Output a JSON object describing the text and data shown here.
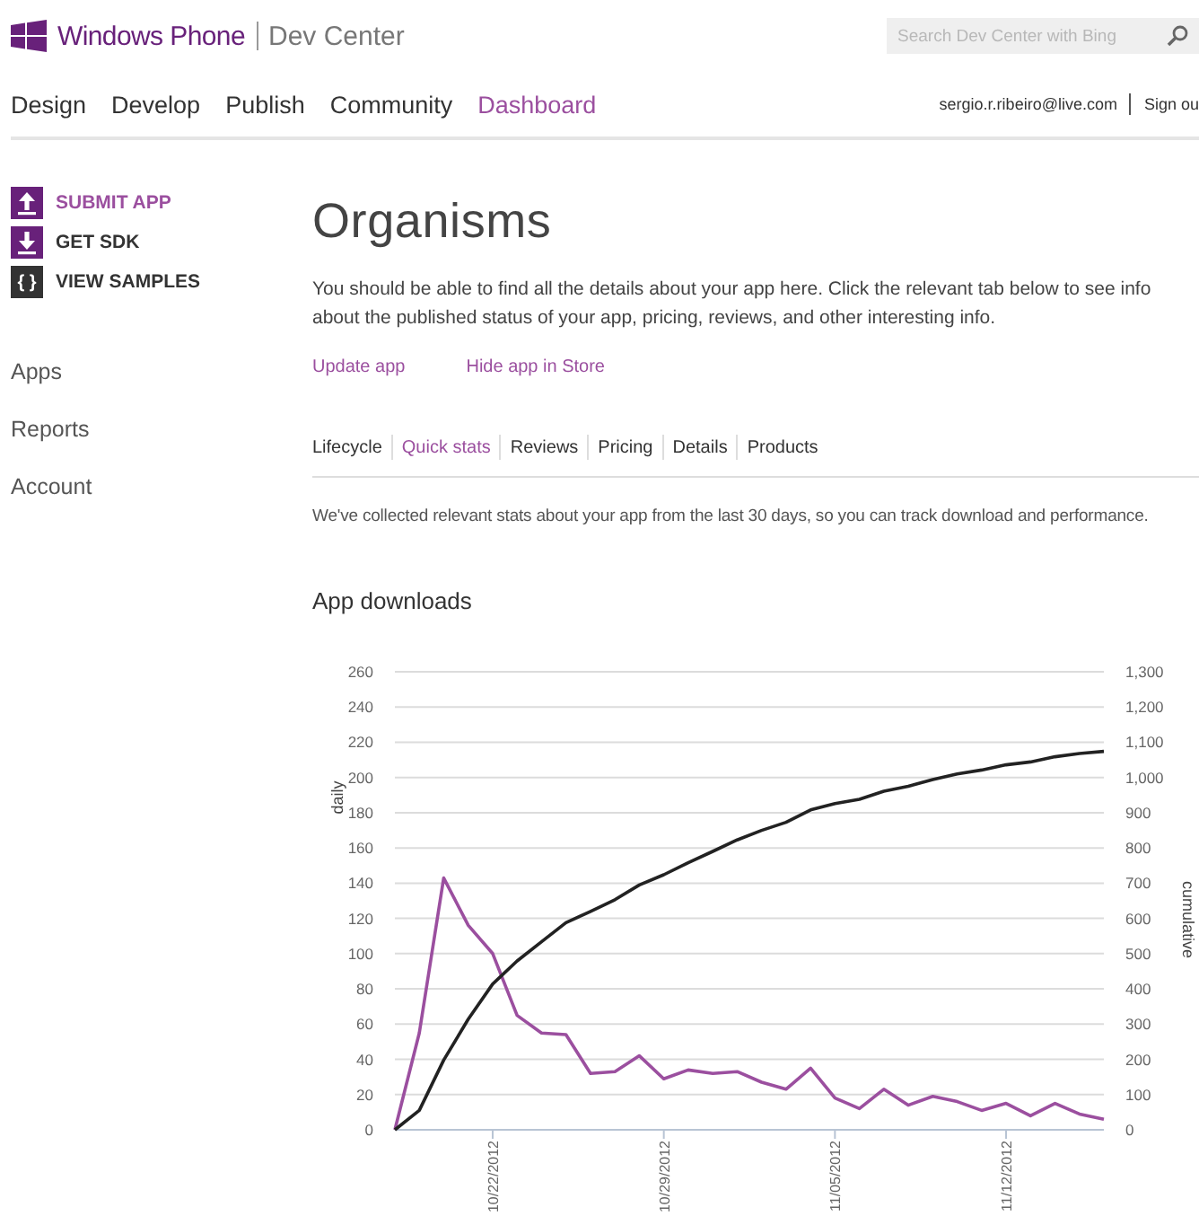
{
  "header": {
    "brand": "Windows Phone",
    "product": "Dev Center",
    "search": {
      "placeholder": "Search Dev Center with Bing"
    }
  },
  "nav": [
    {
      "label": "Design",
      "selected": false
    },
    {
      "label": "Develop",
      "selected": false
    },
    {
      "label": "Publish",
      "selected": false
    },
    {
      "label": "Community",
      "selected": false
    },
    {
      "label": "Dashboard",
      "selected": true
    }
  ],
  "account": {
    "email": "sergio.r.ribeiro@live.com",
    "sign_out": "Sign ou"
  },
  "sidebar": {
    "actions": [
      {
        "kind": "upload",
        "label": "SUBMIT APP",
        "selected": true
      },
      {
        "kind": "download",
        "label": "GET SDK",
        "selected": false
      },
      {
        "kind": "code",
        "label": "VIEW SAMPLES",
        "glyph": "{ }",
        "selected": false
      }
    ],
    "items": [
      "Apps",
      "Reports",
      "Account"
    ]
  },
  "page": {
    "title": "Organisms",
    "intro": "You should be able to find all the details about your app here. Click the relevant tab below to see info about the published status of your app, pricing, reviews, and other interesting info.",
    "links": [
      "Update app",
      "Hide app in Store"
    ],
    "tabs": [
      {
        "label": "Lifecycle",
        "selected": false
      },
      {
        "label": "Quick stats",
        "selected": true
      },
      {
        "label": "Reviews",
        "selected": false
      },
      {
        "label": "Pricing",
        "selected": false
      },
      {
        "label": "Details",
        "selected": false
      },
      {
        "label": "Products",
        "selected": false
      }
    ],
    "stats_intro": "We've collected relevant stats about your app from the last 30 days, so you can track download and performance.",
    "section_title": "App downloads",
    "chart_data": {
      "type": "line",
      "categories": [
        null,
        null,
        null,
        null,
        "10/22/2012",
        null,
        null,
        null,
        null,
        null,
        null,
        "10/29/2012",
        null,
        null,
        null,
        null,
        null,
        null,
        "11/05/2012",
        null,
        null,
        null,
        null,
        null,
        null,
        "11/12/2012",
        null,
        null,
        null,
        null
      ],
      "ylabel": "daily",
      "y2label": "cumulative",
      "grid": true,
      "ylim": [
        0,
        260
      ],
      "y2lim": [
        0,
        1300
      ],
      "yticks": [
        0,
        20,
        40,
        60,
        80,
        100,
        120,
        140,
        160,
        180,
        200,
        220,
        240,
        260
      ],
      "y2ticks": [
        {
          "value": 0,
          "label": "0"
        },
        {
          "value": 100,
          "label": "100"
        },
        {
          "value": 200,
          "label": "200"
        },
        {
          "value": 300,
          "label": "300"
        },
        {
          "value": 400,
          "label": "400"
        },
        {
          "value": 500,
          "label": "500"
        },
        {
          "value": 600,
          "label": "600"
        },
        {
          "value": 700,
          "label": "700"
        },
        {
          "value": 800,
          "label": "800"
        },
        {
          "value": 900,
          "label": "900"
        },
        {
          "value": 1000,
          "label": "1,000"
        },
        {
          "value": 1100,
          "label": "1,100"
        },
        {
          "value": 1200,
          "label": "1,200"
        },
        {
          "value": 1300,
          "label": "1,300"
        }
      ],
      "series": [
        {
          "color": "#9b4f9f",
          "values": [
            0,
            55,
            143,
            116,
            100,
            65,
            55,
            54,
            32,
            33,
            42,
            29,
            34,
            32,
            33,
            27,
            23,
            35,
            18,
            12,
            23,
            14,
            19,
            16,
            11,
            15,
            8,
            15,
            9,
            6
          ]
        },
        {
          "color": "#222222",
          "axis": "y2",
          "values": [
            0,
            55,
            198,
            314,
            414,
            479,
            534,
            588,
            620,
            653,
            695,
            724,
            758,
            790,
            823,
            850,
            873,
            908,
            926,
            938,
            961,
            975,
            994,
            1010,
            1021,
            1036,
            1044,
            1059,
            1068,
            1074
          ]
        }
      ]
    }
  }
}
